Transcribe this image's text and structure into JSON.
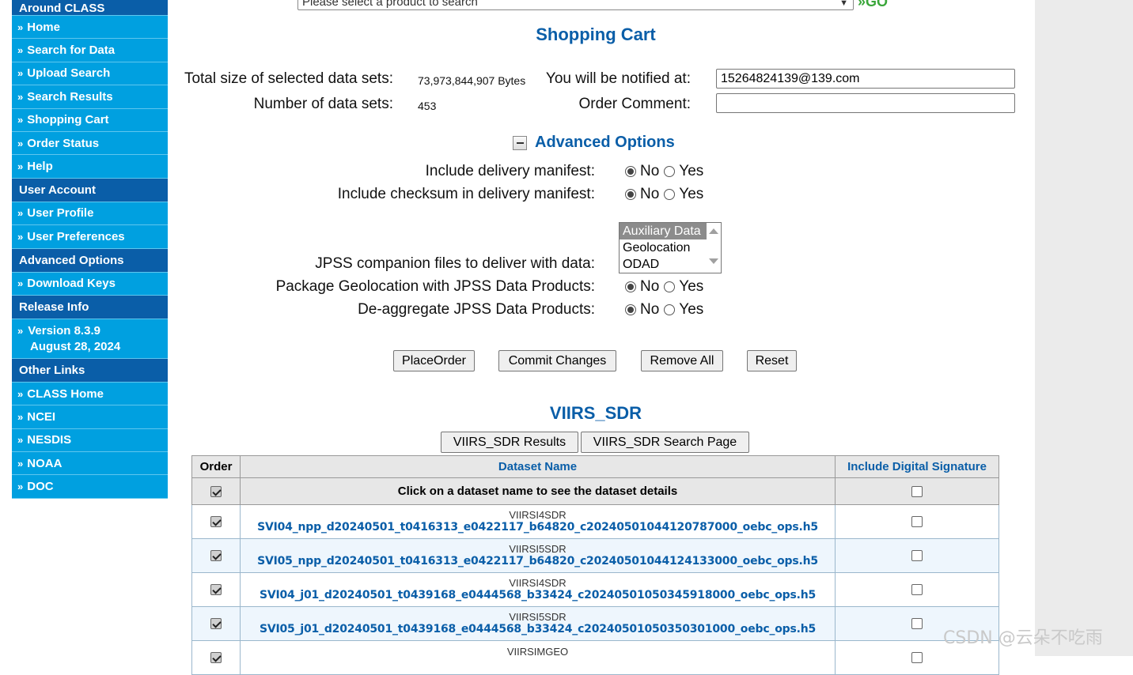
{
  "sidebar": {
    "around_header": "Around CLASS",
    "nav": [
      "Home",
      "Search for Data",
      "Upload Search",
      "Search Results",
      "Shopping Cart",
      "Order Status",
      "Help"
    ],
    "user_header": "User Account",
    "user_items": [
      "User Profile",
      "User Preferences"
    ],
    "adv_header": "Advanced Options",
    "adv_items": [
      "Download Keys"
    ],
    "release_header": "Release Info",
    "version": "Version 8.3.9",
    "version_date": "August 28, 2024",
    "links_header": "Other Links",
    "links": [
      "CLASS Home",
      "NCEI",
      "NESDIS",
      "NOAA",
      "DOC"
    ],
    "arrow": "»"
  },
  "top": {
    "product_select": "Please select a product to search",
    "go_label": "»GO"
  },
  "cart": {
    "title": "Shopping Cart",
    "total_size_label": "Total size of selected data sets:",
    "total_size_value": "73,973,844,907 Bytes",
    "count_label": "Number of data sets:",
    "count_value": "453",
    "notify_label": "You will be notified at:",
    "notify_value": "15264824139@139.com",
    "comment_label": "Order Comment:",
    "comment_value": ""
  },
  "advanced": {
    "title": "Advanced Options",
    "manifest_label": "Include delivery manifest:",
    "checksum_label": "Include checksum in delivery manifest:",
    "companion_label": "JPSS companion files to deliver with data:",
    "companion_options": [
      "Auxiliary Data",
      "Geolocation",
      "ODAD"
    ],
    "package_label": "Package Geolocation with JPSS Data Products:",
    "deagg_label": "De-aggregate JPSS Data Products:",
    "no": "No",
    "yes": "Yes"
  },
  "buttons": {
    "place": "PlaceOrder",
    "commit": "Commit Changes",
    "remove": "Remove All",
    "reset": "Reset"
  },
  "product": {
    "name": "VIIRS_SDR",
    "results_btn": "VIIRS_SDR Results",
    "search_btn": "VIIRS_SDR Search Page"
  },
  "table": {
    "headers": [
      "Order",
      "Dataset Name",
      "Include Digital Signature"
    ],
    "hint": "Click on a dataset name to see the dataset details",
    "rows": [
      {
        "type": "VIIRSI4SDR",
        "file": "SVI04_npp_d20240501_t0416313_e0422117_b64820_c20240501044120787000_oebc_ops.h5"
      },
      {
        "type": "VIIRSI5SDR",
        "file": "SVI05_npp_d20240501_t0416313_e0422117_b64820_c20240501044124133000_oebc_ops.h5"
      },
      {
        "type": "VIIRSI4SDR",
        "file": "SVI04_j01_d20240501_t0439168_e0444568_b33424_c20240501050345918000_oebc_ops.h5"
      },
      {
        "type": "VIIRSI5SDR",
        "file": "SVI05_j01_d20240501_t0439168_e0444568_b33424_c20240501050350301000_oebc_ops.h5"
      },
      {
        "type": "VIIRSIMGEO",
        "file": ""
      }
    ]
  },
  "watermark": "CSDN @云朵不吃雨"
}
